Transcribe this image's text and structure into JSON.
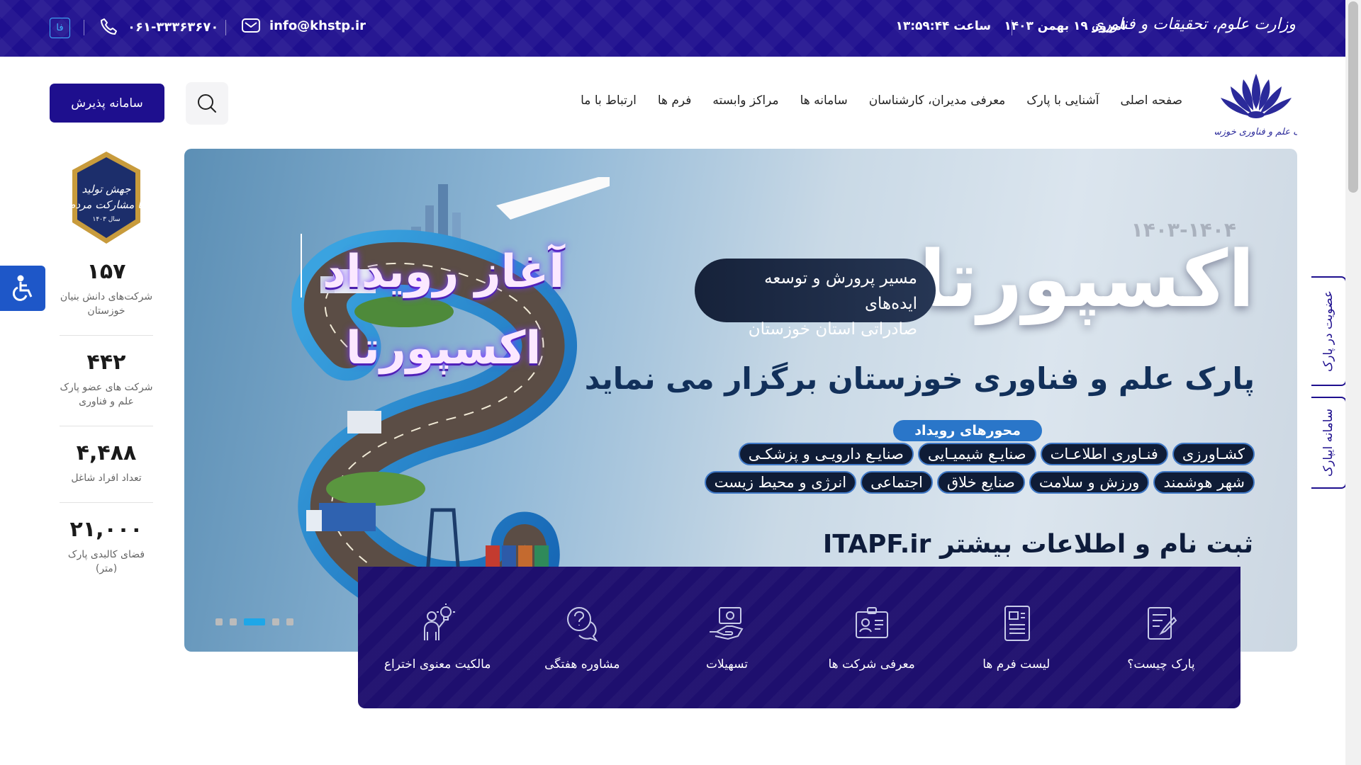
{
  "topbar": {
    "ministry": "وزارت علوم، تحقیقات و فناوری",
    "date": "امروز ۱۹ بهمن ۱۴۰۳",
    "time": "ساعت ۱۳:۵۹:۴۴",
    "email": "info@khstp.ir",
    "phone": "۰۶۱-۳۳۳۶۳۶۷۰",
    "lang": "فا"
  },
  "nav": {
    "items": [
      "صفحه اصلی",
      "آشنایی با پارک",
      "معرفی مدیران، کارشناسان",
      "سامانه ها",
      "مراکز وابسته",
      "فرم ها",
      "ارتباط با ما"
    ],
    "portal_button": "سامانه پذیرش"
  },
  "banner": {
    "title": "اکسپورتا",
    "year": "۱۴۰۳-۱۴۰۴",
    "subtitle_line1": "مسیر پرورش و توسعه ایده‌های",
    "subtitle_line2": "صادراتی استان خوزستان",
    "host": "پارک علم و فناوری خوزستان برگزار می نماید",
    "axes_title": "محورهای رویداد",
    "axes_row1": [
      "کشـاورزی",
      "فنـاوری اطلاعـات",
      "صنایـع شیمیـایی",
      "صنایـع دارویـی و پزشکـی"
    ],
    "axes_row2": [
      "شهر هوشمند",
      "ورزش و سلامت",
      "صنایع خلاق",
      "اجتماعی",
      "انرژی و محیط زیست"
    ],
    "start_line1": "آغاز رویداد",
    "start_line2": "اکسپورتا",
    "register": "ثبت نام و اطلاعات بیشتر ITAPF.ir"
  },
  "services": [
    {
      "label": "پارک چیست؟",
      "icon": "document-edit-icon"
    },
    {
      "label": "لیست فرم ها",
      "icon": "forms-list-icon"
    },
    {
      "label": "معرفی شرکت ها",
      "icon": "id-card-icon"
    },
    {
      "label": "تسهیلات",
      "icon": "hand-money-icon"
    },
    {
      "label": "مشاوره هفتگی",
      "icon": "chat-question-icon"
    },
    {
      "label": "مالکیت معنوی اختراع",
      "icon": "inventor-bulb-icon"
    }
  ],
  "stats": [
    {
      "num": "۱۵۷",
      "label": "شرکت‌های دانش بنیان خوزستان"
    },
    {
      "num": "۴۴۲",
      "label": "شرکت های عضو پارک علم و فناوری"
    },
    {
      "num": "۴,۴۸۸",
      "label": "تعداد افراد شاغل"
    },
    {
      "num": "۲۱,۰۰۰",
      "label": "فضای کالبدی پارک (متر)"
    }
  ],
  "side_tabs": {
    "membership": "عضویت در پارک",
    "ipark": "سامانه ایپارک"
  },
  "colors": {
    "primary": "#1e0f8e",
    "accent": "#1ea7e8",
    "services_bg": "#1e0f6e"
  }
}
